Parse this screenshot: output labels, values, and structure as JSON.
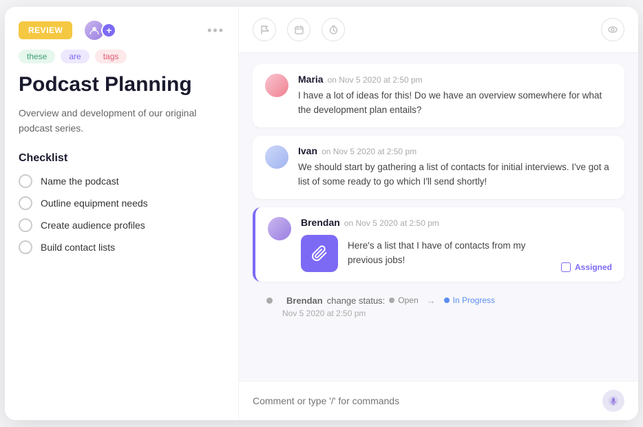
{
  "header": {
    "review_label": "REVIEW",
    "more_label": "•••"
  },
  "tags": [
    {
      "label": "these",
      "type": "green"
    },
    {
      "label": "are",
      "type": "purple"
    },
    {
      "label": "tags",
      "type": "pink"
    }
  ],
  "left": {
    "title": "Podcast Planning",
    "description": "Overview and development of our original podcast series.",
    "checklist_title": "Checklist",
    "checklist_items": [
      "Name the podcast",
      "Outline equipment needs",
      "Create audience profiles",
      "Build contact lists"
    ]
  },
  "right_header": {
    "icon1": "🚩",
    "icon2": "▭",
    "icon3": "⏱"
  },
  "messages": [
    {
      "author": "Maria",
      "time": "on Nov 5 2020 at 2:50 pm",
      "text": "I have a lot of ideas for this! Do we have an overview somewhere for what the development plan entails?",
      "avatar_type": "maria",
      "has_attachment": false
    },
    {
      "author": "Ivan",
      "time": "on Nov 5 2020 at 2:50 pm",
      "text": "We should start by gathering a list of contacts for initial interviews. I've got a list of some ready to go which I'll send shortly!",
      "avatar_type": "ivan",
      "has_attachment": false
    },
    {
      "author": "Brendan",
      "time": "on Nov 5 2020 at 2:50 pm",
      "text": "Here's a list that I have of contacts from my previous jobs!",
      "avatar_type": "brendan",
      "has_attachment": true,
      "assigned_label": "Assigned"
    }
  ],
  "status_change": {
    "author": "Brendan",
    "label": "change status:",
    "from": "Open",
    "to": "In Progress",
    "timestamp": "Nov 5 2020 at 2:50 pm"
  },
  "comment_placeholder": "Comment or type '/' for commands"
}
